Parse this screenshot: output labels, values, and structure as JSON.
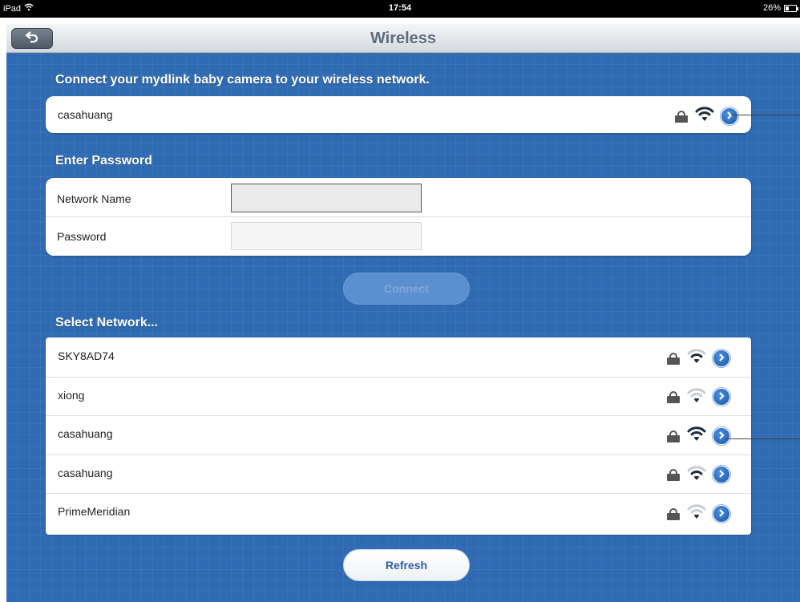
{
  "status_bar": {
    "device": "iPad",
    "time": "17:54",
    "battery": "26%",
    "battery_level": 0.26
  },
  "nav": {
    "title": "Wireless",
    "back_icon": "back-arrow-icon"
  },
  "connect_section": {
    "title": "Connect your mydlink baby camera to your wireless network.",
    "current_network": {
      "ssid": "casahuang",
      "locked": true,
      "signal": "strong"
    }
  },
  "password_section": {
    "title": "Enter Password",
    "network_name_label": "Network Name",
    "network_name_value": "",
    "password_label": "Password",
    "password_value": "",
    "connect_label": "Connect"
  },
  "select_section": {
    "title": "Select Network...",
    "networks": [
      {
        "ssid": "SKY8AD74",
        "locked": true,
        "signal": "medium"
      },
      {
        "ssid": "xiong",
        "locked": true,
        "signal": "weak"
      },
      {
        "ssid": "casahuang",
        "locked": true,
        "signal": "strong"
      },
      {
        "ssid": "casahuang",
        "locked": true,
        "signal": "medium"
      },
      {
        "ssid": "PrimeMeridian",
        "locked": true,
        "signal": "weak"
      }
    ],
    "refresh_label": "Refresh"
  },
  "colors": {
    "background_blue": "#2f6ab2",
    "accent_blue": "#1a56a8",
    "signal_dark": "#1f2d3d",
    "signal_light": "#c8ccd1"
  }
}
